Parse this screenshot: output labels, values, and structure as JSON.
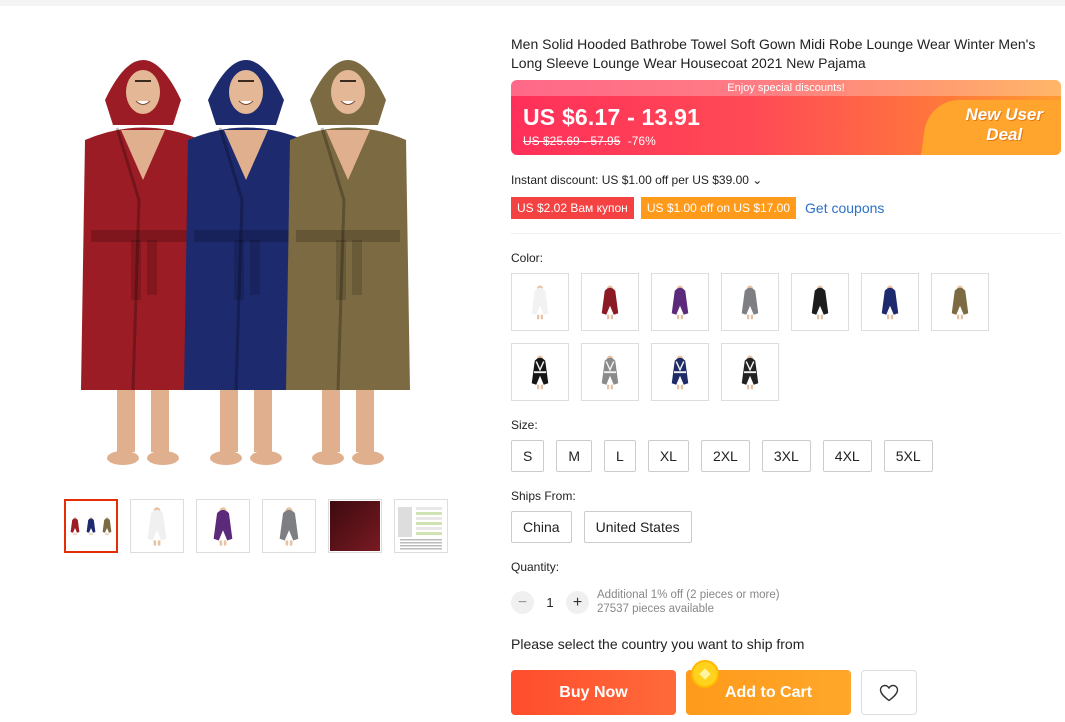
{
  "product": {
    "title": "Men Solid Hooded Bathrobe Towel Soft Gown Midi Robe Lounge Wear Winter Men's Long Sleeve Lounge Wear Housecoat 2021 New Pajama"
  },
  "price": {
    "banner_text": "Enjoy special discounts!",
    "current": "US $6.17 - 13.91",
    "original": "US $25.69 - 57.95",
    "discount": "-76%",
    "badge_line1": "New User",
    "badge_line2": "Deal"
  },
  "instant_discount": "Instant discount: US $1.00 off per US $39.00 ⌄",
  "coupons": [
    {
      "text": "US $2.02 Вам купон",
      "color": "#f44141"
    },
    {
      "text": "US $1.00 off on US $17.00",
      "color": "#ff9a1b"
    }
  ],
  "get_coupons": "Get coupons",
  "color_label": "Color:",
  "colors": [
    {
      "name": "white",
      "color": "#f2f2f2"
    },
    {
      "name": "wine-red",
      "color": "#8b1a24"
    },
    {
      "name": "purple",
      "color": "#5b2a7a"
    },
    {
      "name": "gray",
      "color": "#7d7f82"
    },
    {
      "name": "black",
      "color": "#1c1c1c"
    },
    {
      "name": "navy",
      "color": "#1e2a6e"
    },
    {
      "name": "khaki",
      "color": "#7c6a42"
    },
    {
      "name": "black-white-trim",
      "color": "#151515"
    },
    {
      "name": "gray-white-trim",
      "color": "#8a8a8a"
    },
    {
      "name": "navy-white-trim",
      "color": "#1f2b66"
    },
    {
      "name": "black-white-belt",
      "color": "#222222"
    }
  ],
  "size_label": "Size:",
  "sizes": [
    "S",
    "M",
    "L",
    "XL",
    "2XL",
    "3XL",
    "4XL",
    "5XL"
  ],
  "ships_label": "Ships From:",
  "ships": [
    "China",
    "United States"
  ],
  "quantity_label": "Quantity:",
  "quantity": {
    "value": "1",
    "minus": "−",
    "plus": "+",
    "note1": "Additional 1% off (2 pieces or more)",
    "note2": "27537 pieces available"
  },
  "select_country": "Please select the country you want to ship from",
  "buttons": {
    "buy": "Buy Now",
    "cart": "Add to Cart"
  },
  "gallery": {
    "thumbs": [
      {
        "name": "thumb-three-robes",
        "colors": [
          "#9b1c24",
          "#1e2a6e",
          "#7c6a42"
        ]
      },
      {
        "name": "thumb-white",
        "colors": [
          "#f0f0f0"
        ]
      },
      {
        "name": "thumb-purple",
        "colors": [
          "#5b2a7a"
        ]
      },
      {
        "name": "thumb-gray",
        "colors": [
          "#7d7f82"
        ]
      },
      {
        "name": "thumb-fabric",
        "colors": [
          "#5a1218"
        ]
      },
      {
        "name": "thumb-size-chart",
        "colors": [
          "#e6e6e6"
        ]
      }
    ]
  }
}
